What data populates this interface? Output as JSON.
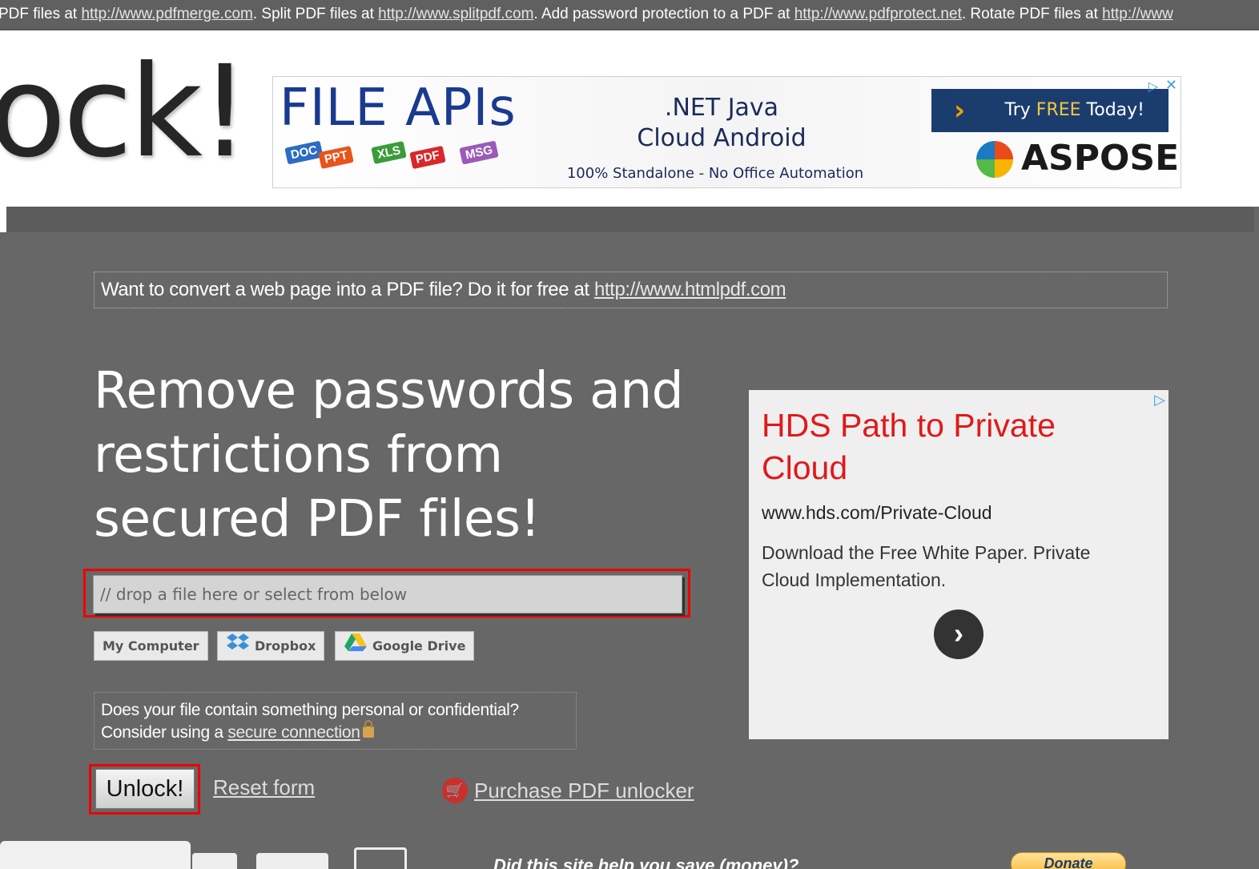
{
  "topbar": {
    "seg1": "PDF files at ",
    "link1": "http://www.pdfmerge.com",
    "seg2": ". Split PDF files at ",
    "link2": "http://www.splitpdf.com",
    "seg3": ". Add password protection to a PDF at ",
    "link3": "http://www.pdfprotect.net",
    "seg4": ". Rotate PDF files at ",
    "link4": "http://www"
  },
  "logo": {
    "text": "ock!"
  },
  "top_ad": {
    "title": "FILE APIs",
    "tags": [
      "DOC",
      "PPT",
      "XLS",
      "PDF",
      "MSG"
    ],
    "langs_line1": ".NET  Java",
    "langs_line2": "Cloud  Android",
    "standalone": "100% Standalone - No Office Automation",
    "cta_pre": "Try ",
    "cta_free": "FREE",
    "cta_post": " Today!",
    "brand": "ASPOSE",
    "colors": {
      "title": "#1a3a8f",
      "cta_bg": "#1b3d6e"
    }
  },
  "promo": {
    "text": "Want to convert a web page into a PDF file? Do it for free at ",
    "link": "http://www.htmlpdf.com"
  },
  "headline": "Remove passwords and restrictions from secured PDF files!",
  "drop": {
    "placeholder": "// drop a file here or select from below"
  },
  "sources": [
    {
      "label": "My Computer",
      "icon": "none"
    },
    {
      "label": "Dropbox",
      "icon": "dropbox-icon"
    },
    {
      "label": "Google Drive",
      "icon": "google-drive-icon"
    }
  ],
  "notice": {
    "line1": "Does your file contain something personal or confidential?",
    "line2": "Consider using a ",
    "link": "secure connection"
  },
  "actions": {
    "unlock": "Unlock!",
    "reset": "Reset form",
    "purchase": "Purchase PDF unlocker"
  },
  "side_ad": {
    "headline": "HDS Path to Private Cloud",
    "url": "www.hds.com/Private-Cloud",
    "desc": "Download the Free White Paper. Private Cloud Implementation.",
    "headline_color": "#e0191b"
  },
  "bottom": {
    "text": "Did this site help you save (money)?",
    "donate": "Donate"
  }
}
